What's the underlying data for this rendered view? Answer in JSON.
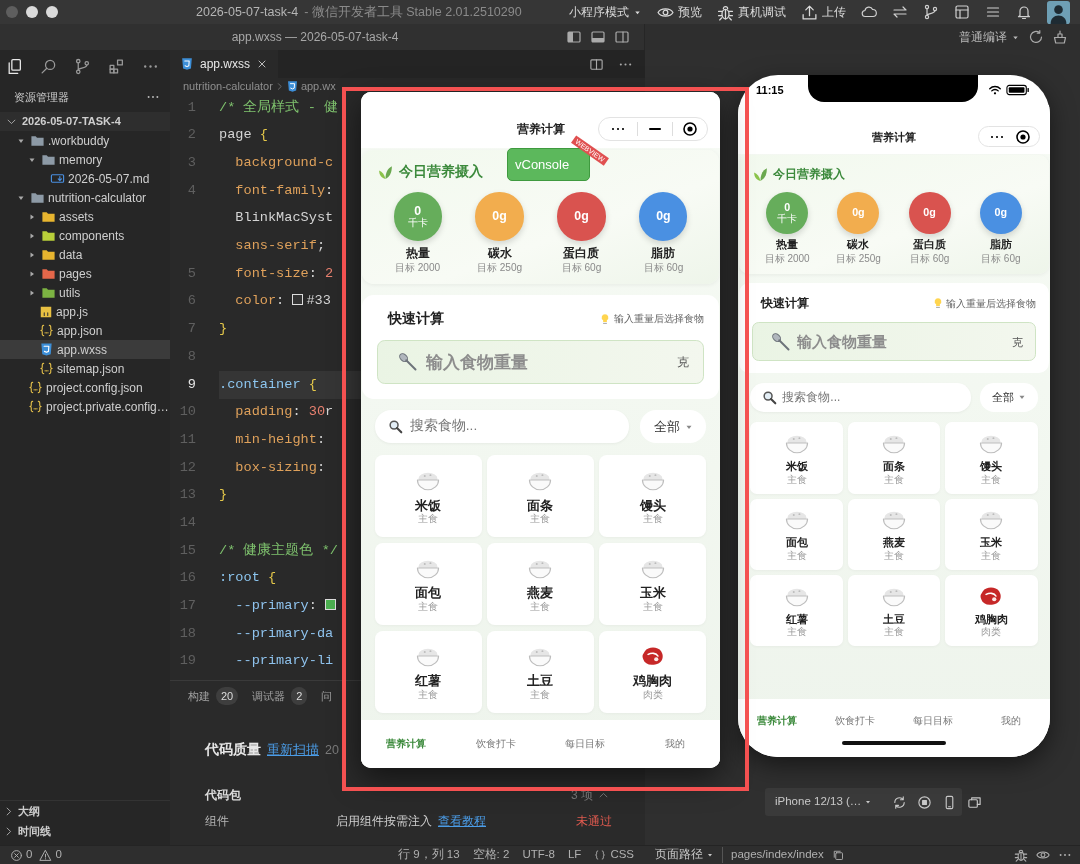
{
  "title_bar": {
    "project": "2026-05-07-task-4",
    "app_name": "- 微信开发者工具 Stable 2.01.2510290",
    "mode": "小程序模式",
    "actions": [
      "预览",
      "真机调试",
      "上传"
    ]
  },
  "editor_title": "app.wxss — 2026-05-07-task-4",
  "compile_mode": "普通编译",
  "explorer": {
    "title": "资源管理器",
    "tree": [
      {
        "label": "2026-05-07-TASK-4",
        "kind": "root",
        "expanded": true,
        "selected": false,
        "children": [
          {
            "label": ".workbuddy",
            "kind": "folder",
            "color": "#8d9aa6",
            "expanded": true,
            "selected": false,
            "children": [
              {
                "label": "memory",
                "kind": "folder",
                "color": "#8d9aa6",
                "expanded": true,
                "selected": false,
                "children": [
                  {
                    "label": "2026-05-07.md",
                    "kind": "markdown",
                    "selected": false
                  }
                ]
              }
            ]
          },
          {
            "label": "nutrition-calculator",
            "kind": "folder",
            "color": "#8d9aa6",
            "expanded": true,
            "selected": false,
            "children": [
              {
                "label": "assets",
                "kind": "folder",
                "color": "#e8b52f",
                "expanded": false,
                "selected": false
              },
              {
                "label": "components",
                "kind": "folder",
                "color": "#b9cf3a",
                "expanded": false,
                "selected": false
              },
              {
                "label": "data",
                "kind": "folder",
                "color": "#e8b52f",
                "expanded": false,
                "selected": false
              },
              {
                "label": "pages",
                "kind": "folder",
                "color": "#e5674a",
                "expanded": false,
                "selected": false
              },
              {
                "label": "utils",
                "kind": "folder",
                "color": "#7cb342",
                "expanded": false,
                "selected": false
              },
              {
                "label": "app.js",
                "kind": "js",
                "selected": false
              },
              {
                "label": "app.json",
                "kind": "json",
                "selected": false
              },
              {
                "label": "app.wxss",
                "kind": "css",
                "selected": true
              },
              {
                "label": "sitemap.json",
                "kind": "json",
                "selected": false
              }
            ]
          },
          {
            "label": "project.config.json",
            "kind": "json",
            "selected": false
          },
          {
            "label": "project.private.config…",
            "kind": "json",
            "selected": false
          }
        ]
      }
    ],
    "sections": [
      "大纲",
      "时间线"
    ]
  },
  "editor": {
    "tabs": [
      {
        "label": "app.wxss",
        "selected": true
      }
    ],
    "breadcrumb": [
      "nutrition-calculator",
      "app.wx"
    ],
    "lines": [
      {
        "number": "1",
        "current": false,
        "tokens": [
          {
            "text": "/* 全局样式 - 健",
            "kind": "comment"
          }
        ]
      },
      {
        "number": "2",
        "current": false,
        "tokens": [
          {
            "text": "page ",
            "kind": "tag"
          },
          {
            "text": "{",
            "kind": "brace"
          }
        ]
      },
      {
        "number": "3",
        "current": false,
        "tokens": [
          {
            "text": "  background-c",
            "kind": "prop"
          }
        ]
      },
      {
        "number": "4",
        "current": false,
        "tokens": [
          {
            "text": "  font-family",
            "kind": "prop"
          },
          {
            "text": ":",
            "kind": "punct"
          }
        ]
      },
      {
        "current": false,
        "tokens": [
          {
            "text": "  BlinkMacSyst",
            "kind": "text"
          }
        ]
      },
      {
        "current": false,
        "tokens": [
          {
            "text": "  sans-serif",
            "kind": "prop"
          },
          {
            "text": ";",
            "kind": "punct"
          }
        ]
      },
      {
        "number": "5",
        "current": false,
        "tokens": [
          {
            "text": "  font-size",
            "kind": "prop"
          },
          {
            "text": ": ",
            "kind": "punct"
          },
          {
            "text": "2",
            "kind": "num"
          }
        ]
      },
      {
        "number": "6",
        "current": false,
        "tokens": [
          {
            "text": "  color",
            "kind": "prop"
          },
          {
            "text": ": ",
            "kind": "punct"
          },
          {
            "kind": "swatch",
            "color": "#333333"
          },
          {
            "text": "#33",
            "kind": "text"
          }
        ]
      },
      {
        "number": "7",
        "current": false,
        "tokens": [
          {
            "text": "}",
            "kind": "brace"
          }
        ]
      },
      {
        "number": "8",
        "current": false
      },
      {
        "number": "9",
        "current": true,
        "tokens": [
          {
            "text": ".container ",
            "kind": "class"
          },
          {
            "text": "{",
            "kind": "brace"
          }
        ]
      },
      {
        "number": "10",
        "current": false,
        "tokens": [
          {
            "text": "  padding",
            "kind": "prop"
          },
          {
            "text": ": ",
            "kind": "punct"
          },
          {
            "text": "30",
            "kind": "num"
          },
          {
            "text": "r",
            "kind": "text"
          }
        ]
      },
      {
        "number": "11",
        "current": false,
        "tokens": [
          {
            "text": "  min-height",
            "kind": "prop"
          },
          {
            "text": ":",
            "kind": "punct"
          }
        ]
      },
      {
        "number": "12",
        "current": false,
        "tokens": [
          {
            "text": "  box-sizing",
            "kind": "prop"
          },
          {
            "text": ":",
            "kind": "punct"
          }
        ]
      },
      {
        "number": "13",
        "current": false,
        "tokens": [
          {
            "text": "}",
            "kind": "brace"
          }
        ]
      },
      {
        "number": "14",
        "current": false
      },
      {
        "number": "15",
        "current": false,
        "tokens": [
          {
            "text": "/* 健康主题色 */",
            "kind": "comment"
          }
        ]
      },
      {
        "number": "16",
        "current": false,
        "tokens": [
          {
            "text": ":root ",
            "kind": "class"
          },
          {
            "text": "{",
            "kind": "brace"
          }
        ]
      },
      {
        "number": "17",
        "current": false,
        "tokens": [
          {
            "text": "  --primary",
            "kind": "var"
          },
          {
            "text": ": ",
            "kind": "punct"
          },
          {
            "kind": "swatch",
            "color": "#4caf50"
          }
        ]
      },
      {
        "number": "18",
        "current": false,
        "tokens": [
          {
            "text": "  --primary-da",
            "kind": "var"
          }
        ]
      },
      {
        "number": "19",
        "current": false,
        "tokens": [
          {
            "text": "  --primary-li",
            "kind": "var"
          }
        ]
      }
    ]
  },
  "panel": {
    "tabs": [
      {
        "label": "构建",
        "count": "20"
      },
      {
        "label": "调试器",
        "count": "2"
      },
      {
        "label": "问"
      }
    ],
    "heading": "代码质量",
    "rescan": "重新扫描",
    "date": "20",
    "rows": [
      {
        "kind": "group",
        "label": "代码包",
        "value": "3 项"
      },
      {
        "kind": "item",
        "label": "组件",
        "detail": "启用组件按需注入",
        "link": "查看教程",
        "status": "未通过"
      }
    ]
  },
  "popup_app": {
    "nav_title": "营养计算",
    "vconsole": "vConsole",
    "vconsole_ribbon": "WEBVIEW",
    "summary_title": "今日营养摄入",
    "nutrients": [
      {
        "value": "0",
        "unit": "千卡",
        "label": "热量",
        "target": "目标 2000",
        "color": "#66ad5b"
      },
      {
        "value": "0g",
        "label": "碳水",
        "target": "目标 250g",
        "color": "#f2ad4e"
      },
      {
        "value": "0g",
        "label": "蛋白质",
        "target": "目标 60g",
        "color": "#d9534f"
      },
      {
        "value": "0g",
        "label": "脂肪",
        "target": "目标 60g",
        "color": "#4a90e2"
      }
    ],
    "quick_title": "快速计算",
    "quick_hint": "输入重量后选择食物",
    "weight_placeholder": "输入食物重量",
    "weight_unit": "克",
    "search_placeholder": "搜索食物...",
    "filter": "全部",
    "foods": [
      {
        "name": "米饭",
        "category": "主食",
        "kind": "grain"
      },
      {
        "name": "面条",
        "category": "主食",
        "kind": "grain"
      },
      {
        "name": "馒头",
        "category": "主食",
        "kind": "grain"
      },
      {
        "name": "面包",
        "category": "主食",
        "kind": "grain"
      },
      {
        "name": "燕麦",
        "category": "主食",
        "kind": "grain"
      },
      {
        "name": "玉米",
        "category": "主食",
        "kind": "grain"
      },
      {
        "name": "红薯",
        "category": "主食",
        "kind": "grain"
      },
      {
        "name": "土豆",
        "category": "主食",
        "kind": "grain"
      },
      {
        "name": "鸡胸肉",
        "category": "肉类",
        "kind": "meat"
      }
    ],
    "tabs": [
      {
        "label": "营养计算",
        "selected": true
      },
      {
        "label": "饮食打卡",
        "selected": false
      },
      {
        "label": "每日目标",
        "selected": false
      },
      {
        "label": "我的",
        "selected": false
      }
    ]
  },
  "phone": {
    "time": "11:15",
    "app": {
      "nav_title": "营养计算",
      "summary_title": "今日营养摄入",
      "nutrients": [
        {
          "value": "0",
          "unit": "千卡",
          "label": "热量",
          "target": "目标 2000",
          "color": "#66ad5b"
        },
        {
          "value": "0g",
          "label": "碳水",
          "target": "目标 250g",
          "color": "#f2ad4e"
        },
        {
          "value": "0g",
          "label": "蛋白质",
          "target": "目标 60g",
          "color": "#d9534f"
        },
        {
          "value": "0g",
          "label": "脂肪",
          "target": "目标 60g",
          "color": "#4a90e2"
        }
      ],
      "quick_title": "快速计算",
      "quick_hint": "输入重量后选择食物",
      "weight_placeholder": "输入食物重量",
      "weight_unit": "克",
      "search_placeholder": "搜索食物...",
      "filter": "全部",
      "foods": [
        {
          "name": "米饭",
          "category": "主食",
          "kind": "grain"
        },
        {
          "name": "面条",
          "category": "主食",
          "kind": "grain"
        },
        {
          "name": "馒头",
          "category": "主食",
          "kind": "grain"
        },
        {
          "name": "面包",
          "category": "主食",
          "kind": "grain"
        },
        {
          "name": "燕麦",
          "category": "主食",
          "kind": "grain"
        },
        {
          "name": "玉米",
          "category": "主食",
          "kind": "grain"
        },
        {
          "name": "红薯",
          "category": "主食",
          "kind": "grain"
        },
        {
          "name": "土豆",
          "category": "主食",
          "kind": "grain"
        },
        {
          "name": "鸡胸肉",
          "category": "肉类",
          "kind": "meat"
        }
      ],
      "tabs": [
        {
          "label": "营养计算",
          "selected": true
        },
        {
          "label": "饮食打卡",
          "selected": false
        },
        {
          "label": "每日目标",
          "selected": false
        },
        {
          "label": "我的",
          "selected": false
        }
      ]
    }
  },
  "device": "iPhone 12/13 (…",
  "status_bar": {
    "errors": "0",
    "warnings": "0",
    "cursor": "行 9，列 13",
    "indent": "空格: 2",
    "encoding": "UTF-8",
    "eol": "LF",
    "language": "CSS",
    "page_path_label": "页面路径",
    "page_path": "pages/index/index"
  }
}
